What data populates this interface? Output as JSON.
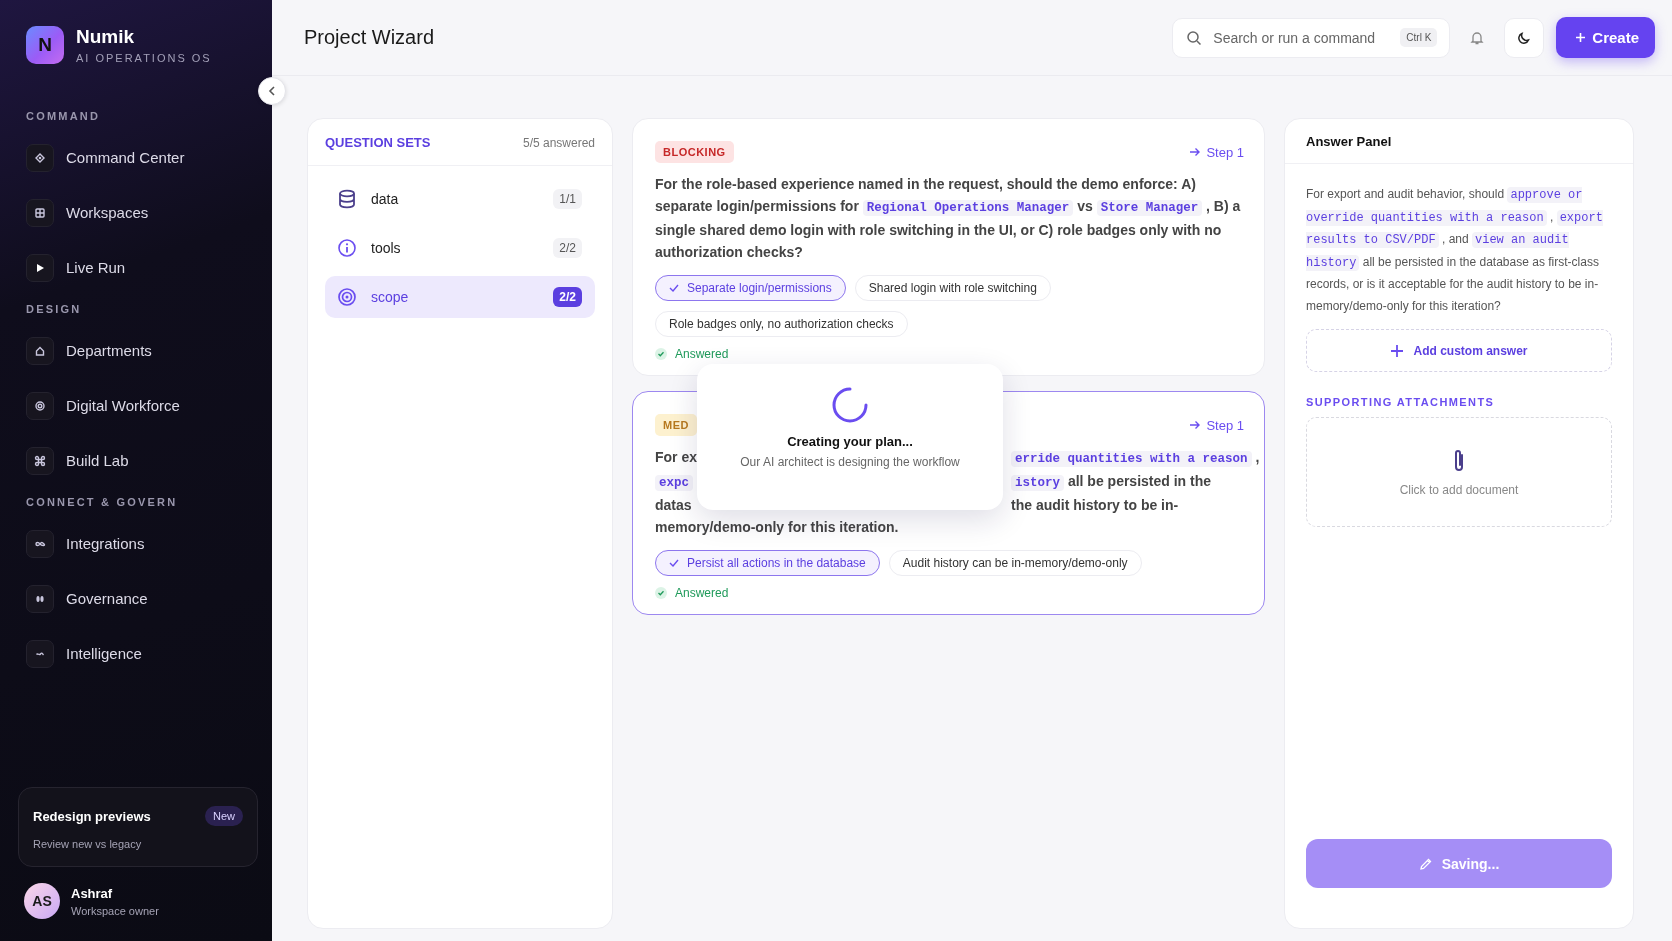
{
  "app": {
    "logo_letter": "N",
    "name": "Numik",
    "tagline": "AI OPERATIONS OS"
  },
  "sidebar": {
    "sections": [
      {
        "heading": "COMMAND",
        "items": [
          {
            "label": "Command Center"
          },
          {
            "label": "Workspaces"
          },
          {
            "label": "Live Run"
          }
        ]
      },
      {
        "heading": "DESIGN",
        "items": [
          {
            "label": "Departments"
          },
          {
            "label": "Digital Workforce"
          },
          {
            "label": "Build Lab"
          }
        ]
      },
      {
        "heading": "CONNECT & GOVERN",
        "items": [
          {
            "label": "Integrations"
          },
          {
            "label": "Governance"
          },
          {
            "label": "Intelligence"
          }
        ]
      }
    ],
    "promo": {
      "title": "Redesign previews",
      "badge": "New",
      "subtitle": "Review new vs legacy"
    },
    "user": {
      "initials": "AS",
      "name": "Ashraf",
      "role": "Workspace owner"
    }
  },
  "topbar": {
    "title": "Project Wizard",
    "search": {
      "placeholder": "Search or run a command",
      "shortcut": "Ctrl K"
    },
    "create_button": "Create"
  },
  "question_sets": {
    "heading": "QUESTION SETS",
    "summary": "5/5 answered",
    "items": [
      {
        "label": "data",
        "count": "1/1",
        "selected": false
      },
      {
        "label": "tools",
        "count": "2/2",
        "selected": false
      },
      {
        "label": "scope",
        "count": "2/2",
        "selected": true
      }
    ]
  },
  "questions": [
    {
      "badge": "BLOCKING",
      "kind": "blocking",
      "step": "Step 1",
      "active": false,
      "segments": [
        {
          "text": "For the role-based experience named in the request, should the demo enforce: A) separate login/permissions for ",
          "code": false
        },
        {
          "text": "Regional Operations Manager",
          "code": true
        },
        {
          "text": " vs ",
          "code": false
        },
        {
          "text": "Store Manager",
          "code": true
        },
        {
          "text": " , B) a single shared demo login with role switching in the UI, or C) role badges only with no authorization checks?",
          "code": false
        }
      ],
      "options": [
        {
          "label": "Separate login/permissions",
          "selected": true
        },
        {
          "label": "Shared login with role switching",
          "selected": false
        },
        {
          "label": "Role badges only, no authorization checks",
          "selected": false
        }
      ],
      "status": "Answered"
    },
    {
      "badge": "MED",
      "kind": "medium",
      "step": "Step 1",
      "active": true,
      "lines": [
        {
          "left": [
            {
              "text": "For ex",
              "code": false
            }
          ],
          "right": [
            {
              "text": "erride quantities with a reason",
              "code": true
            },
            {
              "text": " ,",
              "code": false
            }
          ]
        },
        {
          "left": [
            {
              "text": "expc",
              "code": true
            }
          ],
          "right": [
            {
              "text": "istory",
              "code": true
            },
            {
              "text": " all be persisted in the",
              "code": false
            }
          ]
        },
        {
          "left": [
            {
              "text": "datas",
              "code": false
            }
          ],
          "right": [
            {
              "text": "the audit history to be in-",
              "code": false
            }
          ]
        },
        {
          "full": [
            {
              "text": "memory/demo-only for this iteration.",
              "code": false
            }
          ]
        }
      ],
      "options": [
        {
          "label": "Persist all actions in the database",
          "selected": true
        },
        {
          "label": "Audit history can be in-memory/demo-only",
          "selected": false
        }
      ],
      "status": "Answered"
    }
  ],
  "loading": {
    "title": "Creating your plan...",
    "subtitle": "Our AI architect is designing the workflow"
  },
  "answer_panel": {
    "title": "Answer Panel",
    "segments": [
      {
        "text": "For export and audit behavior, should ",
        "code": false
      },
      {
        "text": "approve or override quantities with a reason",
        "code": true
      },
      {
        "text": " , ",
        "code": false
      },
      {
        "text": "export results to CSV/PDF",
        "code": true
      },
      {
        "text": " , and ",
        "code": false
      },
      {
        "text": "view an audit history",
        "code": true
      },
      {
        "text": " all be persisted in the database as first-class records, or is it acceptable for the audit history to be in-memory/demo-only for this iteration?",
        "code": false
      }
    ],
    "add_button": "Add custom answer",
    "attachments_heading": "SUPPORTING ATTACHMENTS",
    "dropzone": "Click to add document",
    "save_button": {
      "label": "Saving...",
      "busy": true
    }
  }
}
